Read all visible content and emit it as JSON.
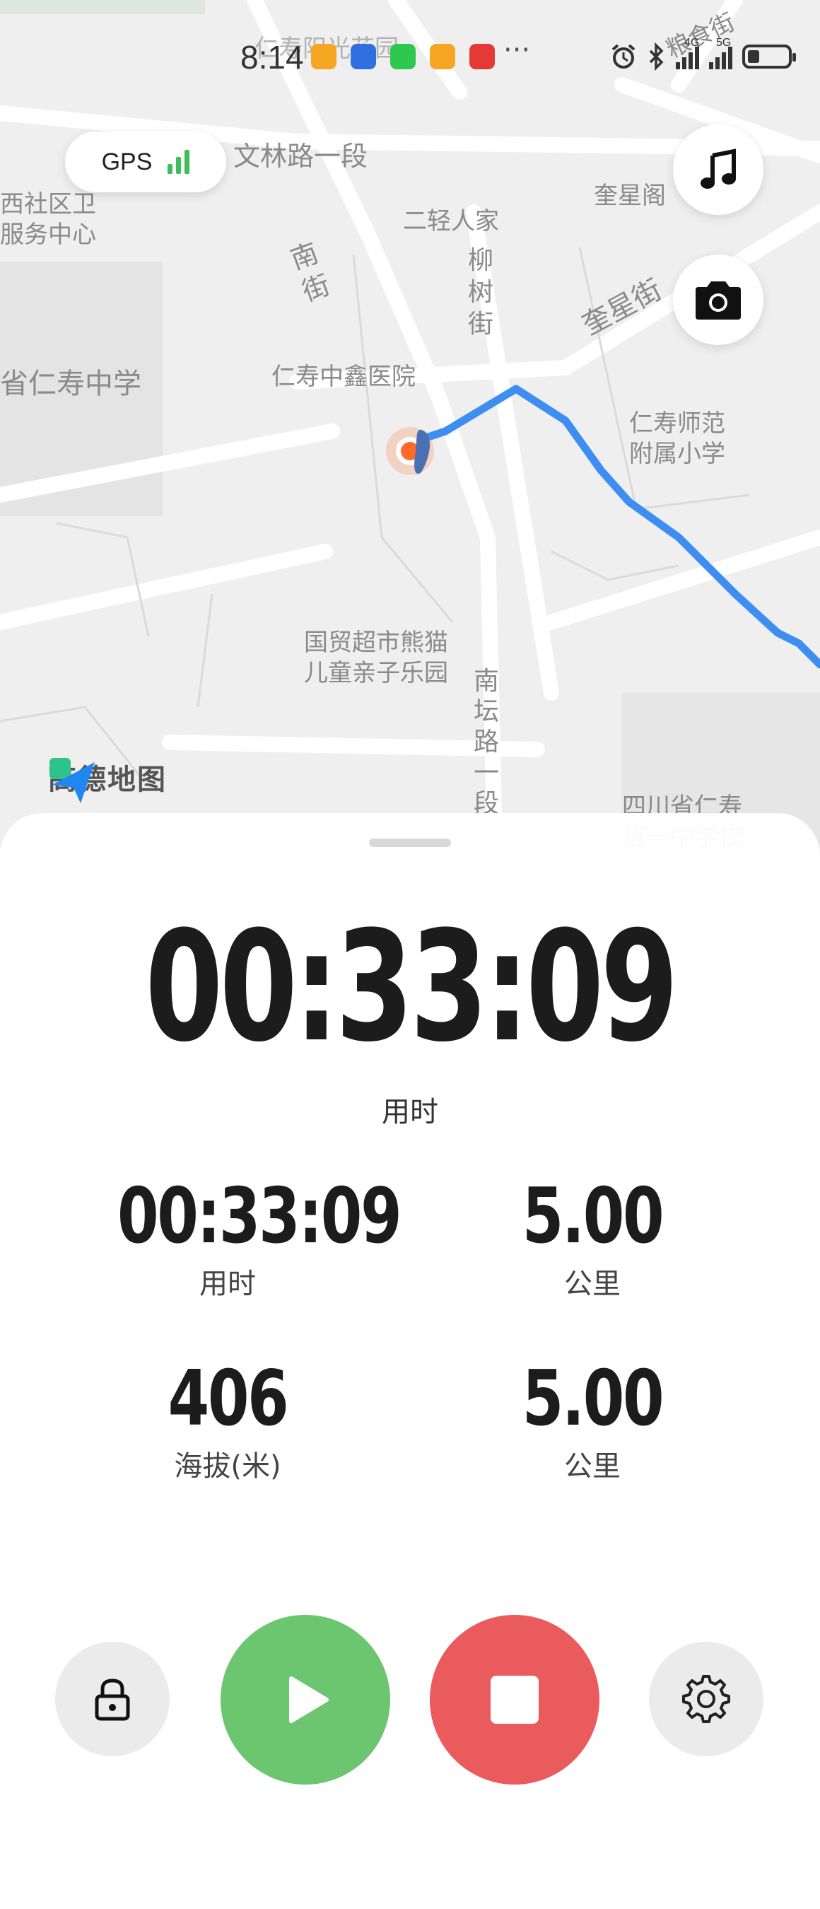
{
  "status_bar": {
    "time": "8:14",
    "overflow": "···",
    "app_icons": [
      {
        "name": "orange-app-icon",
        "color": "#f5a623"
      },
      {
        "name": "blue-app-icon",
        "color": "#2f6fdf"
      },
      {
        "name": "wechat-icon",
        "color": "#2dc84d"
      },
      {
        "name": "orange-app-icon-2",
        "color": "#f5a623"
      },
      {
        "name": "red-app-icon",
        "color": "#e53935"
      }
    ],
    "network_1": "4G",
    "network_2": "5G"
  },
  "map": {
    "gps_label": "GPS",
    "provider": "高德地图",
    "route_color": "#3d8ef0",
    "labels": {
      "wenlin_road": "文林路一段",
      "community_center": "西社区卫\n服务中心",
      "kuixing_pavilion": "奎星阁",
      "erqing_home": "二轻人家",
      "nan_street": "南\n街",
      "liushu_street": "柳\n树\n街",
      "kuixing_street": "奎星街",
      "renshou_middle": "省仁寿中学",
      "zhongxin_hospital": "仁寿中鑫医院",
      "normal_school": "仁寿师范\n附属小学",
      "panda_park": "国贸超市熊猫\n儿童亲子乐园",
      "nantan_road": "南\n坛\n路\n一\n段",
      "sichuan_school": "四川省仁寿\n第一中学校\n(南校区)",
      "top_area": "仁寿阳光花园",
      "food_street": "粮食街"
    }
  },
  "panel": {
    "main_time": "00:33:09",
    "main_time_label": "用时",
    "stats": [
      {
        "value": "00:33:09",
        "label": "用时"
      },
      {
        "value": "5.00",
        "label": "公里"
      },
      {
        "value": "406",
        "label": "海拔(米)"
      },
      {
        "value": "5.00",
        "label": "公里"
      }
    ]
  },
  "colors": {
    "play": "#6cc56f",
    "stop": "#ea5b5e",
    "gps_signal": "#3cbf5a"
  }
}
